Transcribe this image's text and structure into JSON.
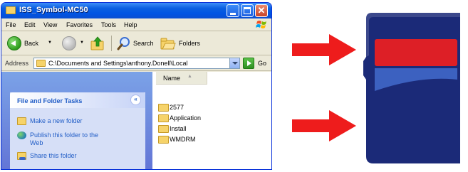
{
  "window": {
    "title": "ISS_Symbol-MC50",
    "buttons": {
      "close": "✕"
    }
  },
  "menu": [
    "File",
    "Edit",
    "View",
    "Favorites",
    "Tools",
    "Help"
  ],
  "toolbar": {
    "back_label": "Back",
    "search_label": "Search",
    "folders_label": "Folders"
  },
  "address": {
    "label": "Address",
    "value": "C:\\Documents and Settings\\anthony.Donell\\Local",
    "go_label": "Go"
  },
  "tasks": {
    "title": "File and Folder Tasks",
    "collapse_glyph": "«",
    "items": [
      "Make a new folder",
      "Publish this folder to the",
      "Web",
      "Share this folder"
    ]
  },
  "files": {
    "column_header": "Name",
    "sort_glyph": "▲",
    "items": [
      "2577",
      "Application",
      "Install",
      "WMDRM"
    ]
  },
  "colors": {
    "arrow": "#ee1c1c",
    "sd_body": "#1b2a78",
    "sd_red": "#dd1f26",
    "sd_blue": "#3c61c0"
  },
  "icons": {
    "back": "back-arrow-icon",
    "forward": "forward-arrow-icon",
    "up": "up-folder-icon",
    "search": "search-magnifier-icon",
    "folders": "folders-icon",
    "go": "go-arrow-icon",
    "new_folder": "new-folder-icon",
    "publish": "globe-icon",
    "share": "share-folder-icon",
    "folder": "folder-icon"
  }
}
